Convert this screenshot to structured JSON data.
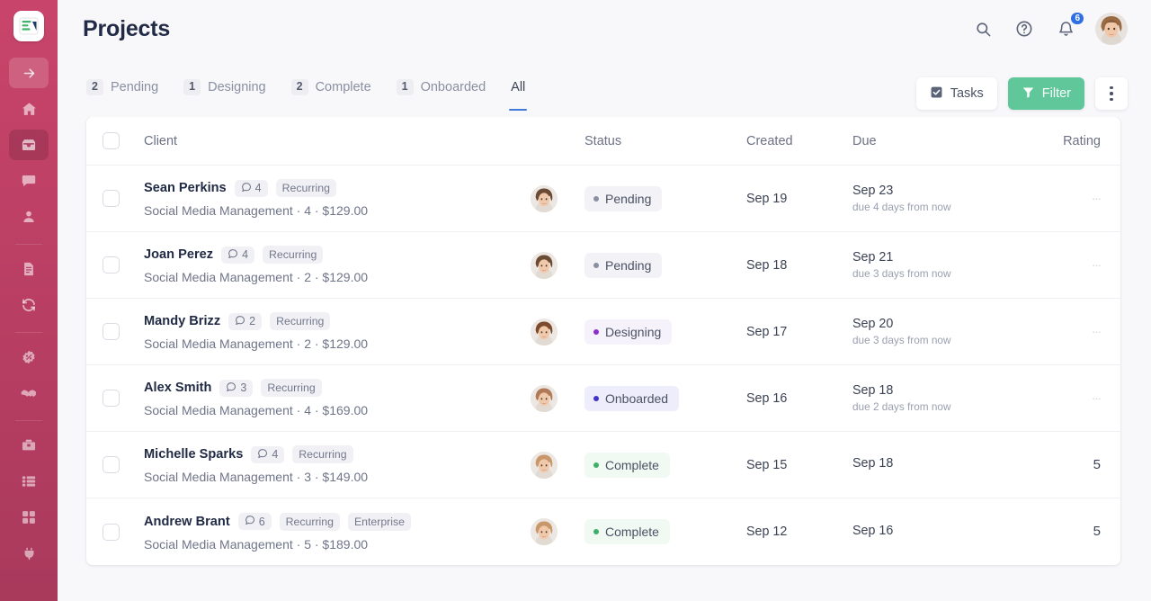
{
  "sidebar": {
    "logo": {
      "icon": "app-logo-icon",
      "colors": {
        "bar": "#3fb36c",
        "triangle": "#1f3864"
      }
    },
    "background_gradient": [
      "#c9446a",
      "#a93a5c"
    ],
    "items": [
      {
        "id": "collapse",
        "icon": "arrow-right-box-icon",
        "boxed": true,
        "active": false
      },
      {
        "id": "home",
        "icon": "home-icon",
        "boxed": false,
        "active": false
      },
      {
        "id": "inbox",
        "icon": "inbox-icon",
        "boxed": false,
        "active": true
      },
      {
        "id": "messages",
        "icon": "chat-bubble-icon",
        "boxed": false,
        "active": false
      },
      {
        "id": "contacts",
        "icon": "person-icon",
        "boxed": false,
        "active": false
      },
      {
        "id": "documents",
        "icon": "document-icon",
        "boxed": false,
        "active": false
      },
      {
        "id": "recurring",
        "icon": "refresh-sync-icon",
        "boxed": false,
        "active": false
      },
      {
        "id": "discounts",
        "icon": "discount-badge-icon",
        "boxed": false,
        "active": false
      },
      {
        "id": "partners",
        "icon": "handshake-icon",
        "boxed": false,
        "active": false
      },
      {
        "id": "tools",
        "icon": "toolbox-icon",
        "boxed": false,
        "active": false
      },
      {
        "id": "lists",
        "icon": "list-icon",
        "boxed": false,
        "active": false
      },
      {
        "id": "grid",
        "icon": "grid-icon",
        "boxed": false,
        "active": false
      },
      {
        "id": "plugins",
        "icon": "plug-icon",
        "boxed": false,
        "active": false
      }
    ]
  },
  "header": {
    "title": "Projects",
    "search_icon": "search-icon",
    "help_icon": "help-circle-icon",
    "bell_icon": "bell-icon",
    "notification_count": "6",
    "notification_color": "#2f6fe4",
    "avatar": "user-avatar"
  },
  "tabs": [
    {
      "count": "2",
      "label": "Pending",
      "active": false
    },
    {
      "count": "1",
      "label": "Designing",
      "active": false
    },
    {
      "count": "2",
      "label": "Complete",
      "active": false
    },
    {
      "count": "1",
      "label": "Onboarded",
      "active": false
    },
    {
      "count": "",
      "label": "All",
      "active": true
    }
  ],
  "toolbar": {
    "tasks_label": "Tasks",
    "tasks_icon": "checkbox-checked-icon",
    "filter_label": "Filter",
    "filter_icon": "funnel-icon",
    "filter_color": "#5fc79a",
    "more_icon": "more-vertical-icon"
  },
  "table": {
    "columns": {
      "client": "Client",
      "status": "Status",
      "created": "Created",
      "due": "Due",
      "rating": "Rating"
    },
    "status_styles": {
      "Pending": {
        "dot": "#8a90a2",
        "bg": "#f3f2f7",
        "text": "#4b5264"
      },
      "Designing": {
        "dot": "#8b2fc9",
        "bg": "#f6f2fb",
        "text": "#4b5264"
      },
      "Onboarded": {
        "dot": "#4134c7",
        "bg": "#eeedfb",
        "text": "#4b5264"
      },
      "Complete": {
        "dot": "#3fae6a",
        "bg": "#f0faf3",
        "text": "#4b5264"
      }
    },
    "rows": [
      {
        "name": "Sean Perkins",
        "comments": "4",
        "tags": [
          "Recurring"
        ],
        "subtitle": "Social Media Management · 4 · $129.00",
        "avatar_tone": "#6b4a36",
        "status": "Pending",
        "created": "Sep 19",
        "due": "Sep 23",
        "due_note": "due 4 days from now",
        "rating": ""
      },
      {
        "name": "Joan Perez",
        "comments": "4",
        "tags": [
          "Recurring"
        ],
        "subtitle": "Social Media Management · 2 · $129.00",
        "avatar_tone": "#6b4a36",
        "status": "Pending",
        "created": "Sep 18",
        "due": "Sep 21",
        "due_note": "due 3 days from now",
        "rating": ""
      },
      {
        "name": "Mandy Brizz",
        "comments": "2",
        "tags": [
          "Recurring"
        ],
        "subtitle": "Social Media Management · 2 · $129.00",
        "avatar_tone": "#7c4a2c",
        "status": "Designing",
        "created": "Sep 17",
        "due": "Sep 20",
        "due_note": "due 3 days from now",
        "rating": ""
      },
      {
        "name": "Alex Smith",
        "comments": "3",
        "tags": [
          "Recurring"
        ],
        "subtitle": "Social Media Management · 4 · $169.00",
        "avatar_tone": "#b07a58",
        "status": "Onboarded",
        "created": "Sep 16",
        "due": "Sep 18",
        "due_note": "due 2 days from now",
        "rating": ""
      },
      {
        "name": "Michelle Sparks",
        "comments": "4",
        "tags": [
          "Recurring"
        ],
        "subtitle": "Social Media Management · 3 · $149.00",
        "avatar_tone": "#c8976a",
        "status": "Complete",
        "created": "Sep 15",
        "due": "Sep 18",
        "due_note": "",
        "rating": "5"
      },
      {
        "name": "Andrew Brant",
        "comments": "6",
        "tags": [
          "Recurring",
          "Enterprise"
        ],
        "subtitle": "Social Media Management · 5 · $189.00",
        "avatar_tone": "#c8976a",
        "status": "Complete",
        "created": "Sep 12",
        "due": "Sep 16",
        "due_note": "",
        "rating": "5"
      }
    ]
  }
}
